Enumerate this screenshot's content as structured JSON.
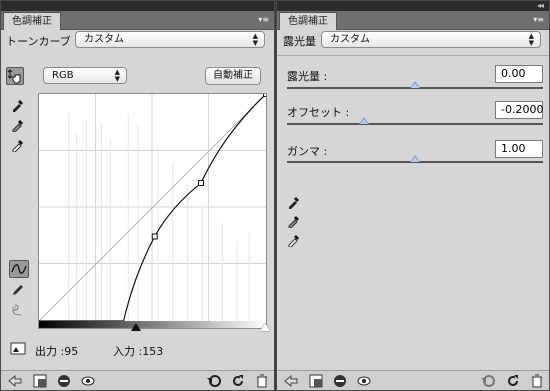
{
  "left_panel": {
    "tab_title": "色調補正",
    "preset_label": "トーンカーブ",
    "preset_value": "カスタム",
    "channel_value": "RGB",
    "auto_button": "自動補正",
    "output_label": "出力 :95",
    "input_label": "入力 :153",
    "curve": {
      "points": [
        [
          0,
          0
        ],
        [
          95,
          0
        ],
        [
          130,
          95
        ],
        [
          182,
          155
        ],
        [
          255,
          255
        ]
      ]
    }
  },
  "right_panel": {
    "tab_title": "色調補正",
    "preset_label": "露光量",
    "preset_value": "カスタム",
    "exposure": {
      "label": "露光量 :",
      "value": "0.00",
      "slider": 0.5
    },
    "offset": {
      "label": "オフセット :",
      "value": "-0.2000",
      "slider": 0.3
    },
    "gamma": {
      "label": "ガンマ :",
      "value": "1.00",
      "slider": 0.5
    }
  },
  "icons": {
    "menu": "panel-menu-icon",
    "eyedropper": "eyedropper-icon"
  }
}
